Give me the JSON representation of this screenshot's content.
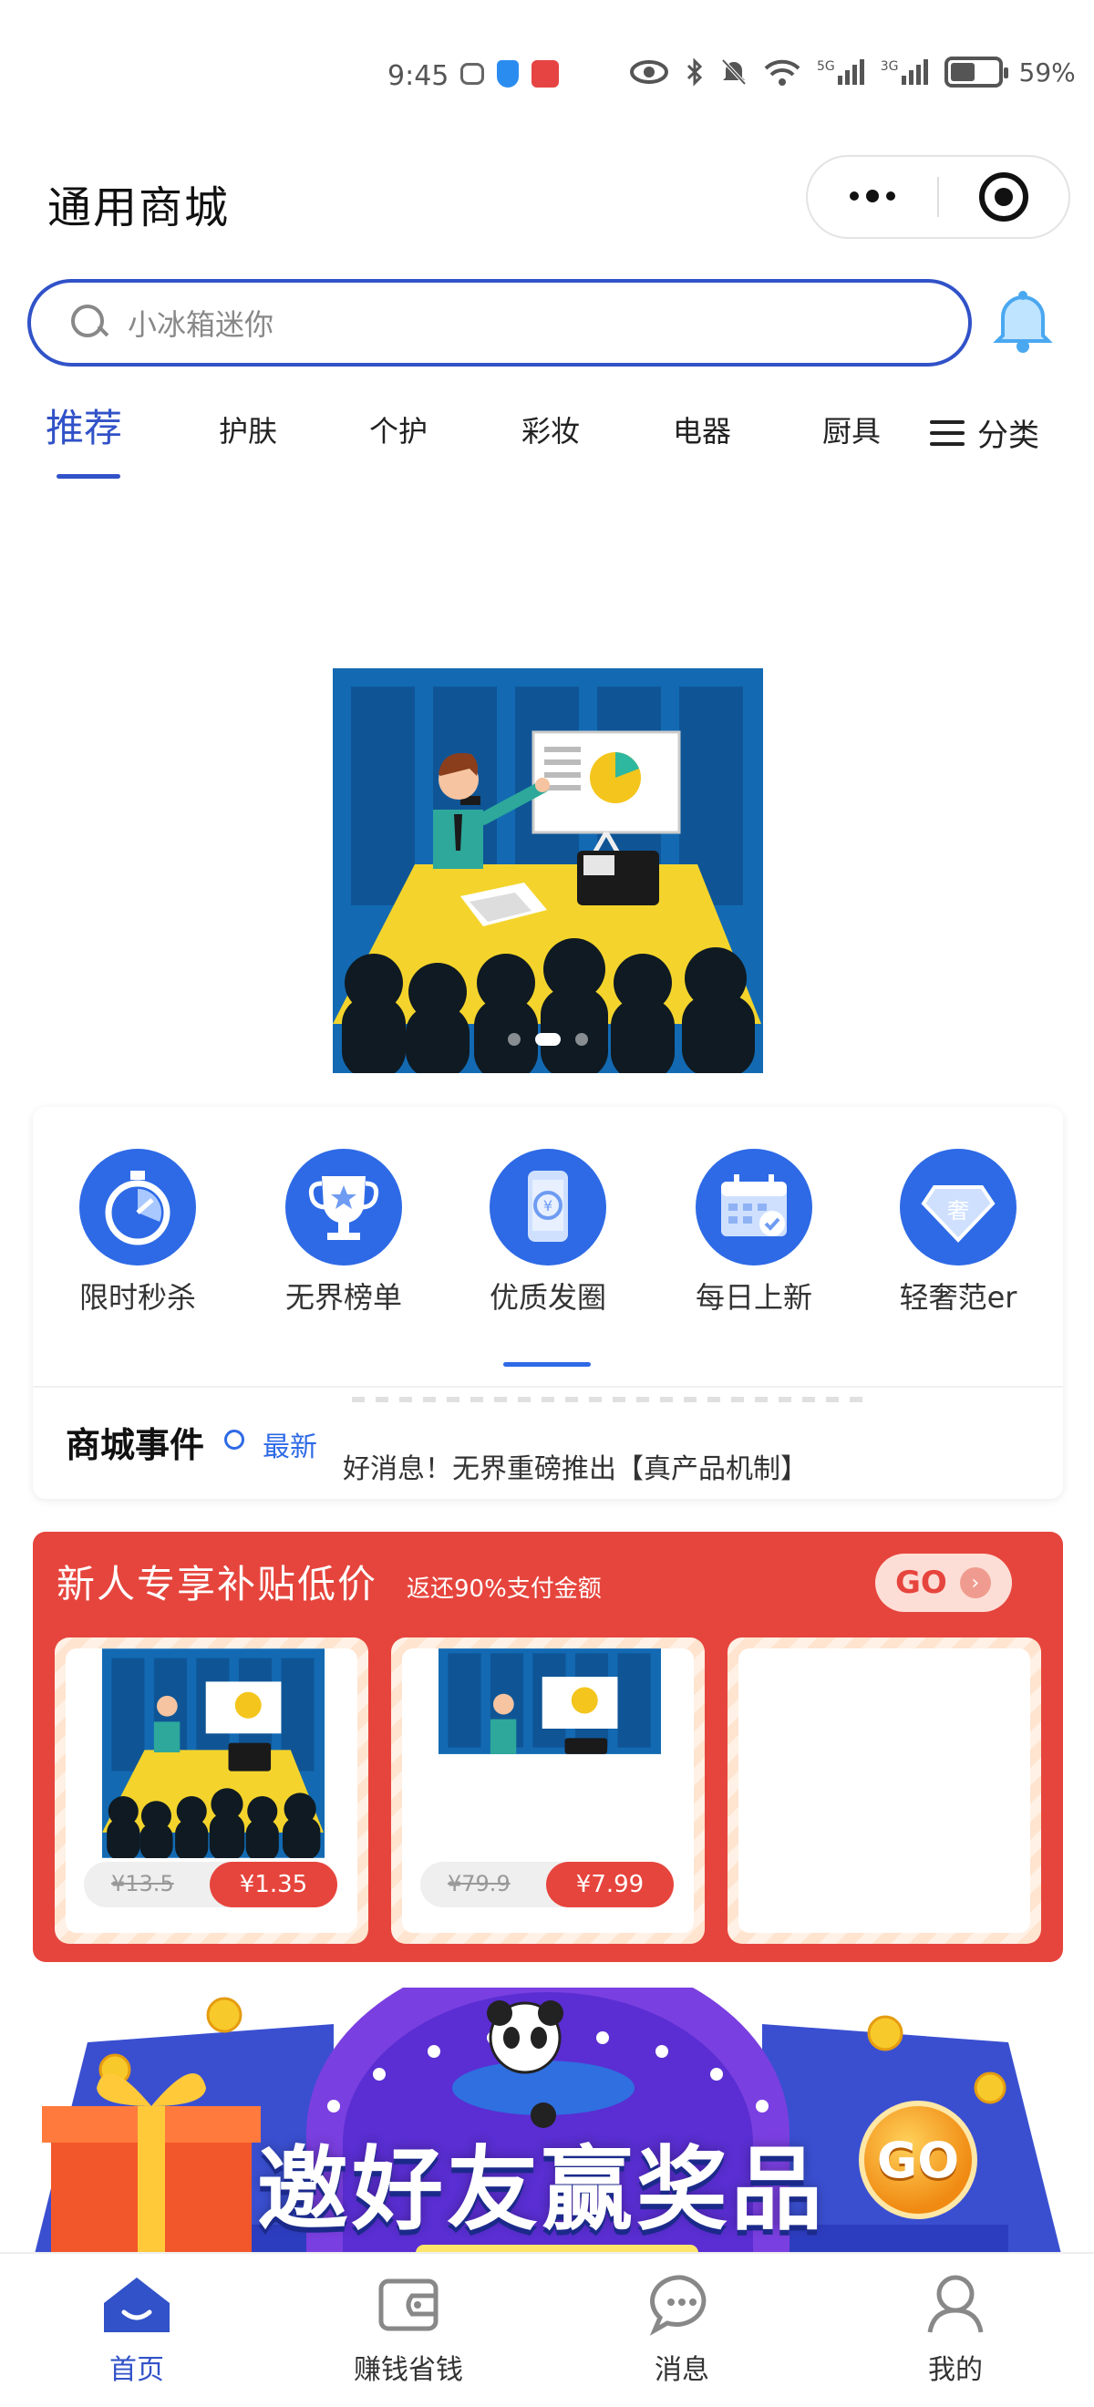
{
  "status_bar": {
    "time": "9:45",
    "network_5g": "5G",
    "network_3g": "3G",
    "battery_percent": "59%"
  },
  "app": {
    "title": "通用商城"
  },
  "search": {
    "placeholder": "小冰箱迷你"
  },
  "tabs": {
    "items": [
      "推荐",
      "护肤",
      "个护",
      "彩妆",
      "电器",
      "厨具"
    ],
    "active_index": 0,
    "category_label": "分类"
  },
  "quick_nav": {
    "items": [
      {
        "label": "限时秒杀",
        "icon": "stopwatch-icon"
      },
      {
        "label": "无界榜单",
        "icon": "trophy-icon"
      },
      {
        "label": "优质发圈",
        "icon": "phone-coin-icon"
      },
      {
        "label": "每日上新",
        "icon": "calendar-new-icon"
      },
      {
        "label": "轻奢范er",
        "icon": "diamond-icon"
      }
    ]
  },
  "news": {
    "title": "商城事件",
    "tag": "最新",
    "text": "好消息！无界重磅推出【真产品机制】"
  },
  "subsidy": {
    "title": "新人专享补贴低价",
    "subtitle": "返还90%支付金额",
    "go_label": "GO",
    "products": [
      {
        "old_price": "¥13.5",
        "new_price": "¥1.35"
      },
      {
        "old_price": "¥79.9",
        "new_price": "¥7.99"
      }
    ]
  },
  "invite": {
    "title": "邀好友赢奖品",
    "go_label": "GO"
  },
  "bottom_nav": {
    "items": [
      {
        "label": "首页",
        "icon": "home-icon"
      },
      {
        "label": "赚钱省钱",
        "icon": "wallet-icon"
      },
      {
        "label": "消息",
        "icon": "chat-icon"
      },
      {
        "label": "我的",
        "icon": "user-icon"
      }
    ],
    "active_index": 0
  },
  "colors": {
    "primary_blue": "#3152c8",
    "icon_blue": "#2e6ae6",
    "subsidy_red": "#e6453d"
  }
}
